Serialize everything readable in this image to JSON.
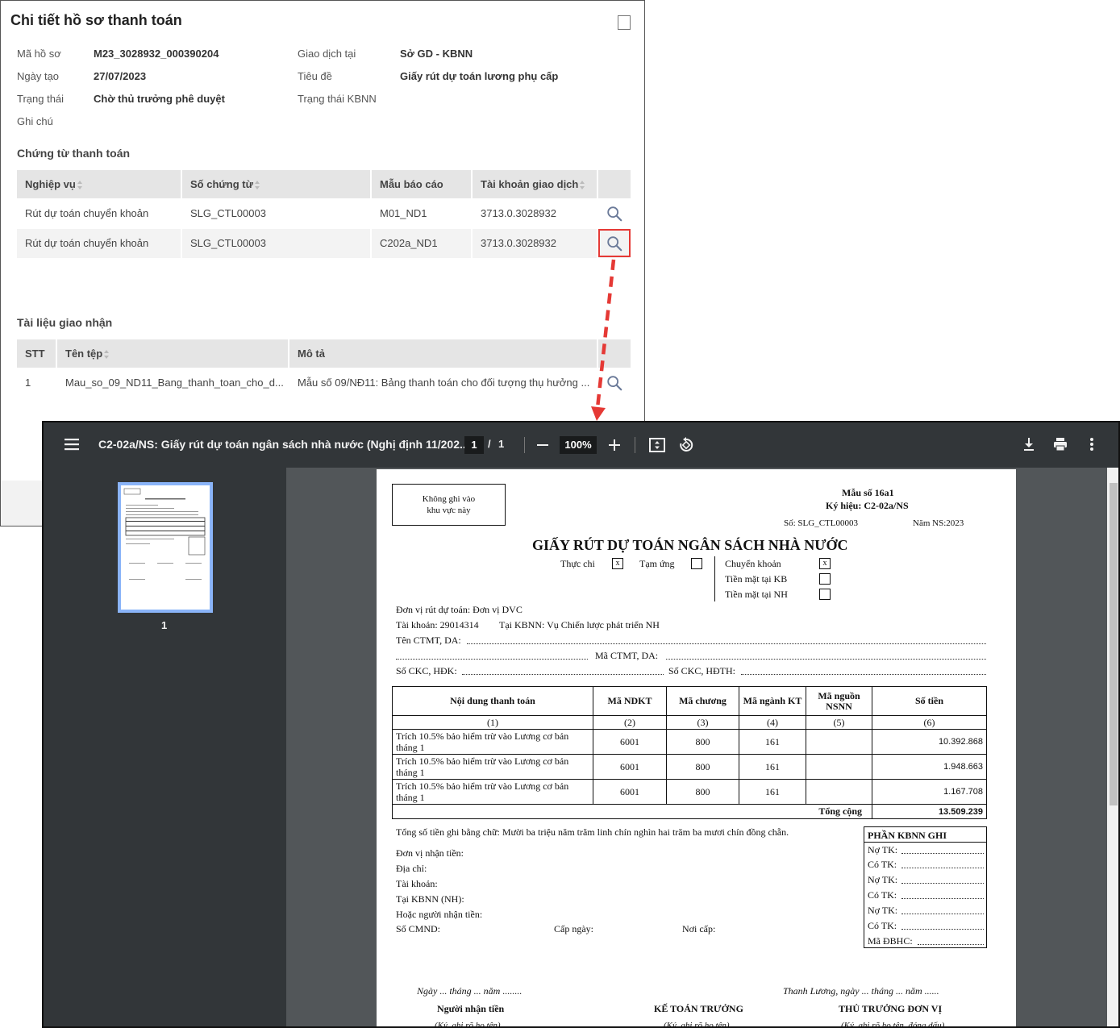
{
  "panel": {
    "title": "Chi tiết hồ sơ thanh toán",
    "fields": {
      "ma_ho_so_label": "Mã hồ sơ",
      "ma_ho_so": "M23_3028932_000390204",
      "ngay_tao_label": "Ngày tạo",
      "ngay_tao": "27/07/2023",
      "trang_thai_label": "Trạng thái",
      "trang_thai": "Chờ thủ trưởng phê duyệt",
      "ghi_chu_label": "Ghi chú",
      "giao_dich_tai_label": "Giao dịch tại",
      "giao_dich_tai": "Sở GD - KBNN",
      "tieu_de_label": "Tiêu đề",
      "tieu_de": "Giấy rút dự toán lương phụ cấp",
      "trang_thai_kbnn_label": "Trạng thái KBNN"
    },
    "chung_tu": {
      "title": "Chứng từ thanh toán",
      "headers": [
        "Nghiệp vụ",
        "Số chứng từ",
        "Mẫu báo cáo",
        "Tài khoản giao dịch"
      ],
      "rows": [
        [
          "Rút dự toán chuyển khoản",
          "SLG_CTL00003",
          "M01_ND1",
          "3713.0.3028932"
        ],
        [
          "Rút dự toán chuyển khoản",
          "SLG_CTL00003",
          "C202a_ND1",
          "3713.0.3028932"
        ]
      ]
    },
    "tai_lieu": {
      "title": "Tài liệu giao nhận",
      "headers": [
        "STT",
        "Tên tệp",
        "Mô tả"
      ],
      "rows": [
        [
          "1",
          "Mau_so_09_ND11_Bang_thanh_toan_cho_d...",
          "Mẫu số 09/NĐ11: Bảng thanh toán cho đối tượng thụ hưởng ..."
        ]
      ]
    }
  },
  "viewer": {
    "title": "C2-02a/NS: Giấy rút dự toán ngân sách nhà nước (Nghị định 11/202...",
    "page": "1",
    "sep": "/",
    "total": "1",
    "zoom": "100%",
    "thumb_num": "1"
  },
  "doc": {
    "box": [
      "Không ghi vào",
      "khu vực này"
    ],
    "mau_so": "Mẫu số 16a1",
    "ky_hieu": "Ký hiệu: C2-02a/NS",
    "so": "Số: SLG_CTL00003",
    "nam": "Năm NS:2023",
    "title": "GIẤY RÚT DỰ TOÁN NGÂN SÁCH NHÀ NƯỚC",
    "thuc_chi": "Thực chi",
    "thuc_chi_mark": "x",
    "tam_ung": "Tạm ứng",
    "chuyen_khoan": "Chuyển khoản",
    "ck_mark": "x",
    "tien_mat_kb": "Tiền mặt tại KB",
    "tien_mat_nh": "Tiền mặt tại NH",
    "don_vi": "Đơn vị rút dự toán:  Đơn vị DVC",
    "tai_khoan": "Tài khoản: 29014314",
    "tai_kbnn": "Tại KBNN: Vụ Chiến lược phát triển NH",
    "ten_ctmt": "Tên CTMT, DA:",
    "ma_ctmt": "Mã CTMT, DA:",
    "so_ckc": "Số CKC, HĐK:",
    "so_ckc_hdth": "Số CKC, HĐTH:",
    "table_headers": [
      "Nội dung thanh toán",
      "Mã NDKT",
      "Mã chương",
      "Mã  ngành KT",
      "Mã nguồn NSNN",
      "Số tiền"
    ],
    "table_nums": [
      "(1)",
      "(2)",
      "(3)",
      "(4)",
      "(5)",
      "(6)"
    ],
    "rows": [
      [
        "Trích 10.5% bảo hiểm trừ vào Lương cơ bản tháng 1",
        "6001",
        "800",
        "161",
        "",
        "10.392.868"
      ],
      [
        "Trích 10.5% bảo hiểm trừ vào Lương cơ bản tháng 1",
        "6001",
        "800",
        "161",
        "",
        "1.948.663"
      ],
      [
        "Trích 10.5% bảo hiểm trừ vào Lương cơ bản tháng 1",
        "6001",
        "800",
        "161",
        "",
        "1.167.708"
      ]
    ],
    "tong_cong": "Tổng cộng",
    "tong_tien": "13.509.239",
    "bang_chu": "Tổng số tiền ghi bằng chữ: Mười ba triệu năm trăm linh chín nghìn hai trăm ba mươi chín đồng chẵn.",
    "nhan_tien": [
      "Đơn vị nhận tiền:",
      "Địa chỉ:",
      "Tài khoản:",
      "Tại KBNN (NH):",
      "Hoặc người nhận tiền:"
    ],
    "so_cmnd": "Số CMND:",
    "cap_ngay": "Cấp ngày:",
    "noi_cap": "Nơi cấp:",
    "kbnn_title": "PHẦN KBNN GHI",
    "kbnn_lines": [
      "Nợ TK:",
      "Có TK:",
      "Nợ TK:",
      "Có TK:",
      "Nợ TK:",
      "Có TK:",
      "Mã ĐBHC:"
    ],
    "ngay_left": "Ngày ... tháng ... năm ........",
    "ngay_right": "Thanh Lương, ngày ... tháng ... năm ......",
    "nguoi_nhan": "Người nhận tiền",
    "ke_toan": "KẾ TOÁN TRƯỞNG",
    "thu_truong": "THỦ TRƯỞNG ĐƠN VỊ",
    "ky_left": "(Ký, ghi rõ họ tên)",
    "ky_mid": "(Ký, ghi rõ họ tên)",
    "ky_right": "(Ký, ghi rõ họ tên, đóng dấu)"
  },
  "colors": {
    "highlight": "#e53935",
    "toolbar": "#323639",
    "viewer_bg": "#525659",
    "thumb_border": "#8ab4f8"
  },
  "icons": [
    "maximize-icon",
    "search-icon",
    "menu-icon",
    "minus-icon",
    "plus-icon",
    "fit-page-icon",
    "rotate-icon",
    "download-icon",
    "print-icon",
    "more-icon"
  ]
}
